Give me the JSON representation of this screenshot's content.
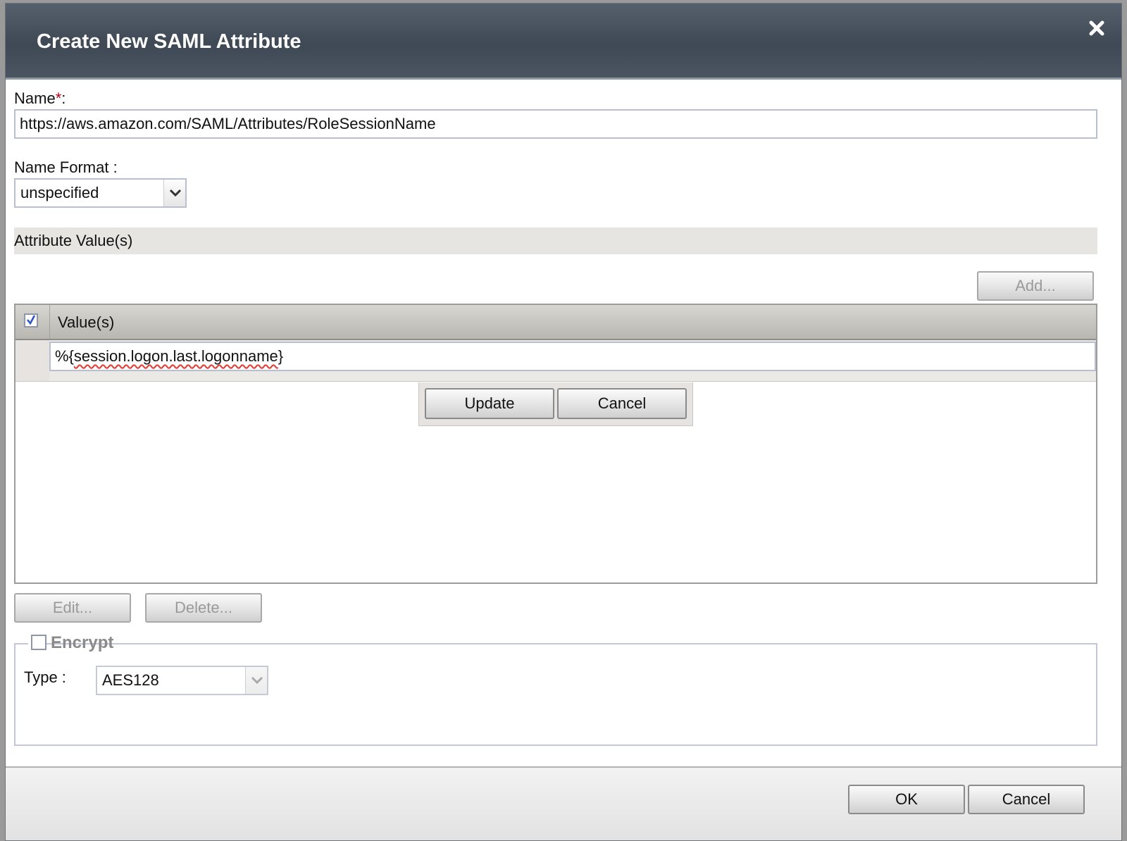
{
  "dialog": {
    "title": "Create New SAML Attribute",
    "close_icon": "close-icon"
  },
  "name_field": {
    "label": "Name",
    "required_marker": "*",
    "label_suffix": ":",
    "value": "https://aws.amazon.com/SAML/Attributes/RoleSessionName"
  },
  "name_format": {
    "label": "Name Format :",
    "selected": "unspecified"
  },
  "attribute_values": {
    "section_title": "Attribute Value(s)",
    "add_button": "Add...",
    "column_header": "Value(s)",
    "header_checked": true,
    "editing_row_value": "%{session.logon.last.logonname}",
    "update_button": "Update",
    "cancel_button": "Cancel",
    "edit_button": "Edit...",
    "delete_button": "Delete..."
  },
  "encrypt": {
    "label": "Encrypt",
    "checked": false,
    "type_label": "Type :",
    "type_selected": "AES128"
  },
  "footer": {
    "ok_button": "OK",
    "cancel_button": "Cancel"
  },
  "colors": {
    "titlebar": "#46505c",
    "section_bar": "#e6e5e1",
    "checkbox_check": "#2f55c8",
    "required": "#b3001b"
  }
}
